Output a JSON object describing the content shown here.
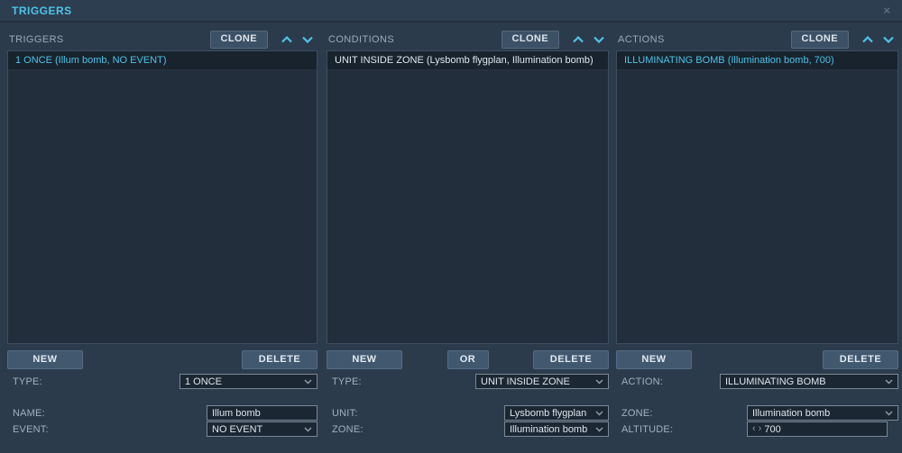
{
  "titlebar": {
    "title": "TRIGGERS",
    "close_glyph": "×"
  },
  "colors": {
    "accent_cyan": "#4ec3e8",
    "background": "#2b3b4c",
    "list_background": "#222e3b",
    "list_row_background": "#18232e",
    "button_background": "#41586f",
    "field_background": "#1b2733",
    "selected_item_text": "#4ec3e8",
    "normal_item_text": "#dfe7ee"
  },
  "icons": {
    "spinner_left": "‹",
    "spinner_right": "›"
  },
  "panels": [
    {
      "header": "TRIGGERS",
      "clone_label": "CLONE",
      "items": [
        {
          "label": "1 ONCE (Illum bomb, NO EVENT)",
          "selected": true
        }
      ],
      "new_label": "NEW",
      "delete_label": "DELETE",
      "type": {
        "label": "TYPE:",
        "value": "1 ONCE"
      },
      "name": {
        "label": "NAME:",
        "value": "Illum bomb"
      },
      "event": {
        "label": "EVENT:",
        "value": "NO EVENT"
      }
    },
    {
      "header": "CONDITIONS",
      "clone_label": "CLONE",
      "items": [
        {
          "label": "UNIT INSIDE ZONE (Lysbomb flygplan, Illumination bomb)",
          "selected": false
        }
      ],
      "new_label": "NEW",
      "or_label": "OR",
      "delete_label": "DELETE",
      "type": {
        "label": "TYPE:",
        "value": "UNIT INSIDE ZONE"
      },
      "unit": {
        "label": "UNIT:",
        "value": "Lysbomb flygplan"
      },
      "zone": {
        "label": "ZONE:",
        "value": "Illumination bomb"
      }
    },
    {
      "header": "ACTIONS",
      "clone_label": "CLONE",
      "items": [
        {
          "label": "ILLUMINATING BOMB (Illumination bomb, 700)",
          "selected": true
        }
      ],
      "new_label": "NEW",
      "delete_label": "DELETE",
      "action": {
        "label": "ACTION:",
        "value": "ILLUMINATING BOMB"
      },
      "zone": {
        "label": "ZONE:",
        "value": "Illumination bomb"
      },
      "altitude": {
        "label": "ALTITUDE:",
        "value": "700"
      }
    }
  ]
}
